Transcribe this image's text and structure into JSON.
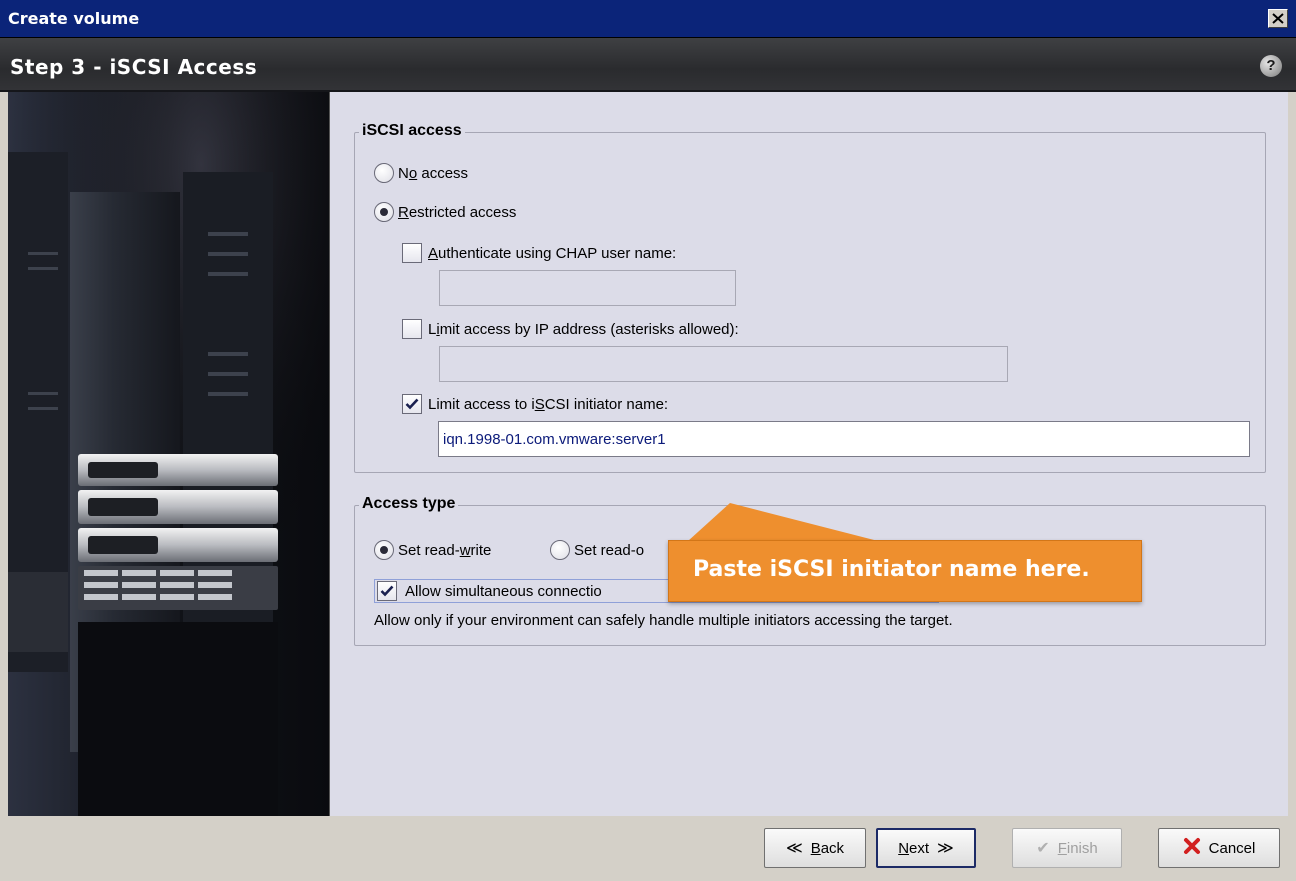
{
  "window": {
    "title": "Create volume"
  },
  "step": {
    "title": "Step 3 - iSCSI Access",
    "help_icon": "?"
  },
  "iscsi_access": {
    "legend": "iSCSI access",
    "no_access": {
      "label_u": "o",
      "label_prefix": "N",
      "label_rest": " access",
      "selected": false
    },
    "restricted_access": {
      "label_u": "R",
      "label_rest": "estricted access",
      "selected": true
    },
    "chap": {
      "label_u": "A",
      "label_rest": "uthenticate using CHAP user name:",
      "checked": false,
      "value": ""
    },
    "ip": {
      "label_prefix": "L",
      "label_u": "i",
      "label_rest": "mit access by IP address (asterisks allowed):",
      "checked": false,
      "value": ""
    },
    "initiator": {
      "label_prefix": "Limit access to i",
      "label_u": "S",
      "label_rest": "CSI initiator name:",
      "checked": true,
      "value": "iqn.1998-01.com.vmware:server1"
    }
  },
  "access_type": {
    "legend": "Access type",
    "read_write": {
      "label_prefix": "Set read-",
      "label_u": "w",
      "label_rest": "rite",
      "selected": true
    },
    "read_only": {
      "label": "Set read-o",
      "selected": false
    },
    "simultaneous": {
      "label": "Allow simultaneous connectio",
      "checked": true
    },
    "note": "Allow only if your environment can safely handle multiple initiators accessing the target."
  },
  "callout": {
    "text": "Paste iSCSI initiator name here.",
    "color": "#ee8f2e"
  },
  "buttons": {
    "back": {
      "label_u": "B",
      "label_rest": "ack"
    },
    "next": {
      "label_u": "N",
      "label_rest": "ext"
    },
    "finish": {
      "label_u": "F",
      "label_rest": "inish"
    },
    "cancel": {
      "label": "Cancel"
    }
  }
}
